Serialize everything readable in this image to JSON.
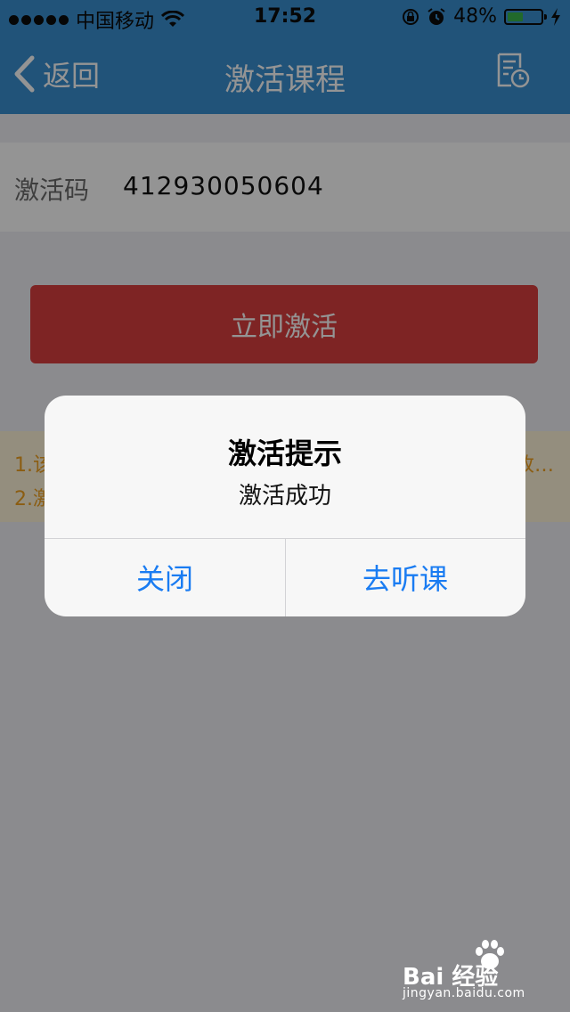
{
  "status_bar": {
    "carrier": "中国移动",
    "time": "17:52",
    "battery_percent": "48%",
    "battery_level": 0.48
  },
  "nav": {
    "back_label": "返回",
    "title": "激活课程",
    "right_icon": "history-list-icon"
  },
  "form": {
    "code_label": "激活码",
    "code_value": "412930050604",
    "activate_label": "立即激活"
  },
  "notice": {
    "line1_prefix": "1.该",
    "line1_suffix": "改…",
    "line2_prefix": "2.激"
  },
  "dialog": {
    "title": "激活提示",
    "message": "激活成功",
    "close_label": "关闭",
    "go_label": "去听课"
  },
  "watermark": {
    "brand_text": "Bai 经验",
    "url": "jingyan.baidu.com"
  },
  "colors": {
    "nav_bar": "#3a8fd0",
    "activate_button": "#d93e3e",
    "dialog_link": "#1a7cf2",
    "notice_text": "#f0a020"
  }
}
